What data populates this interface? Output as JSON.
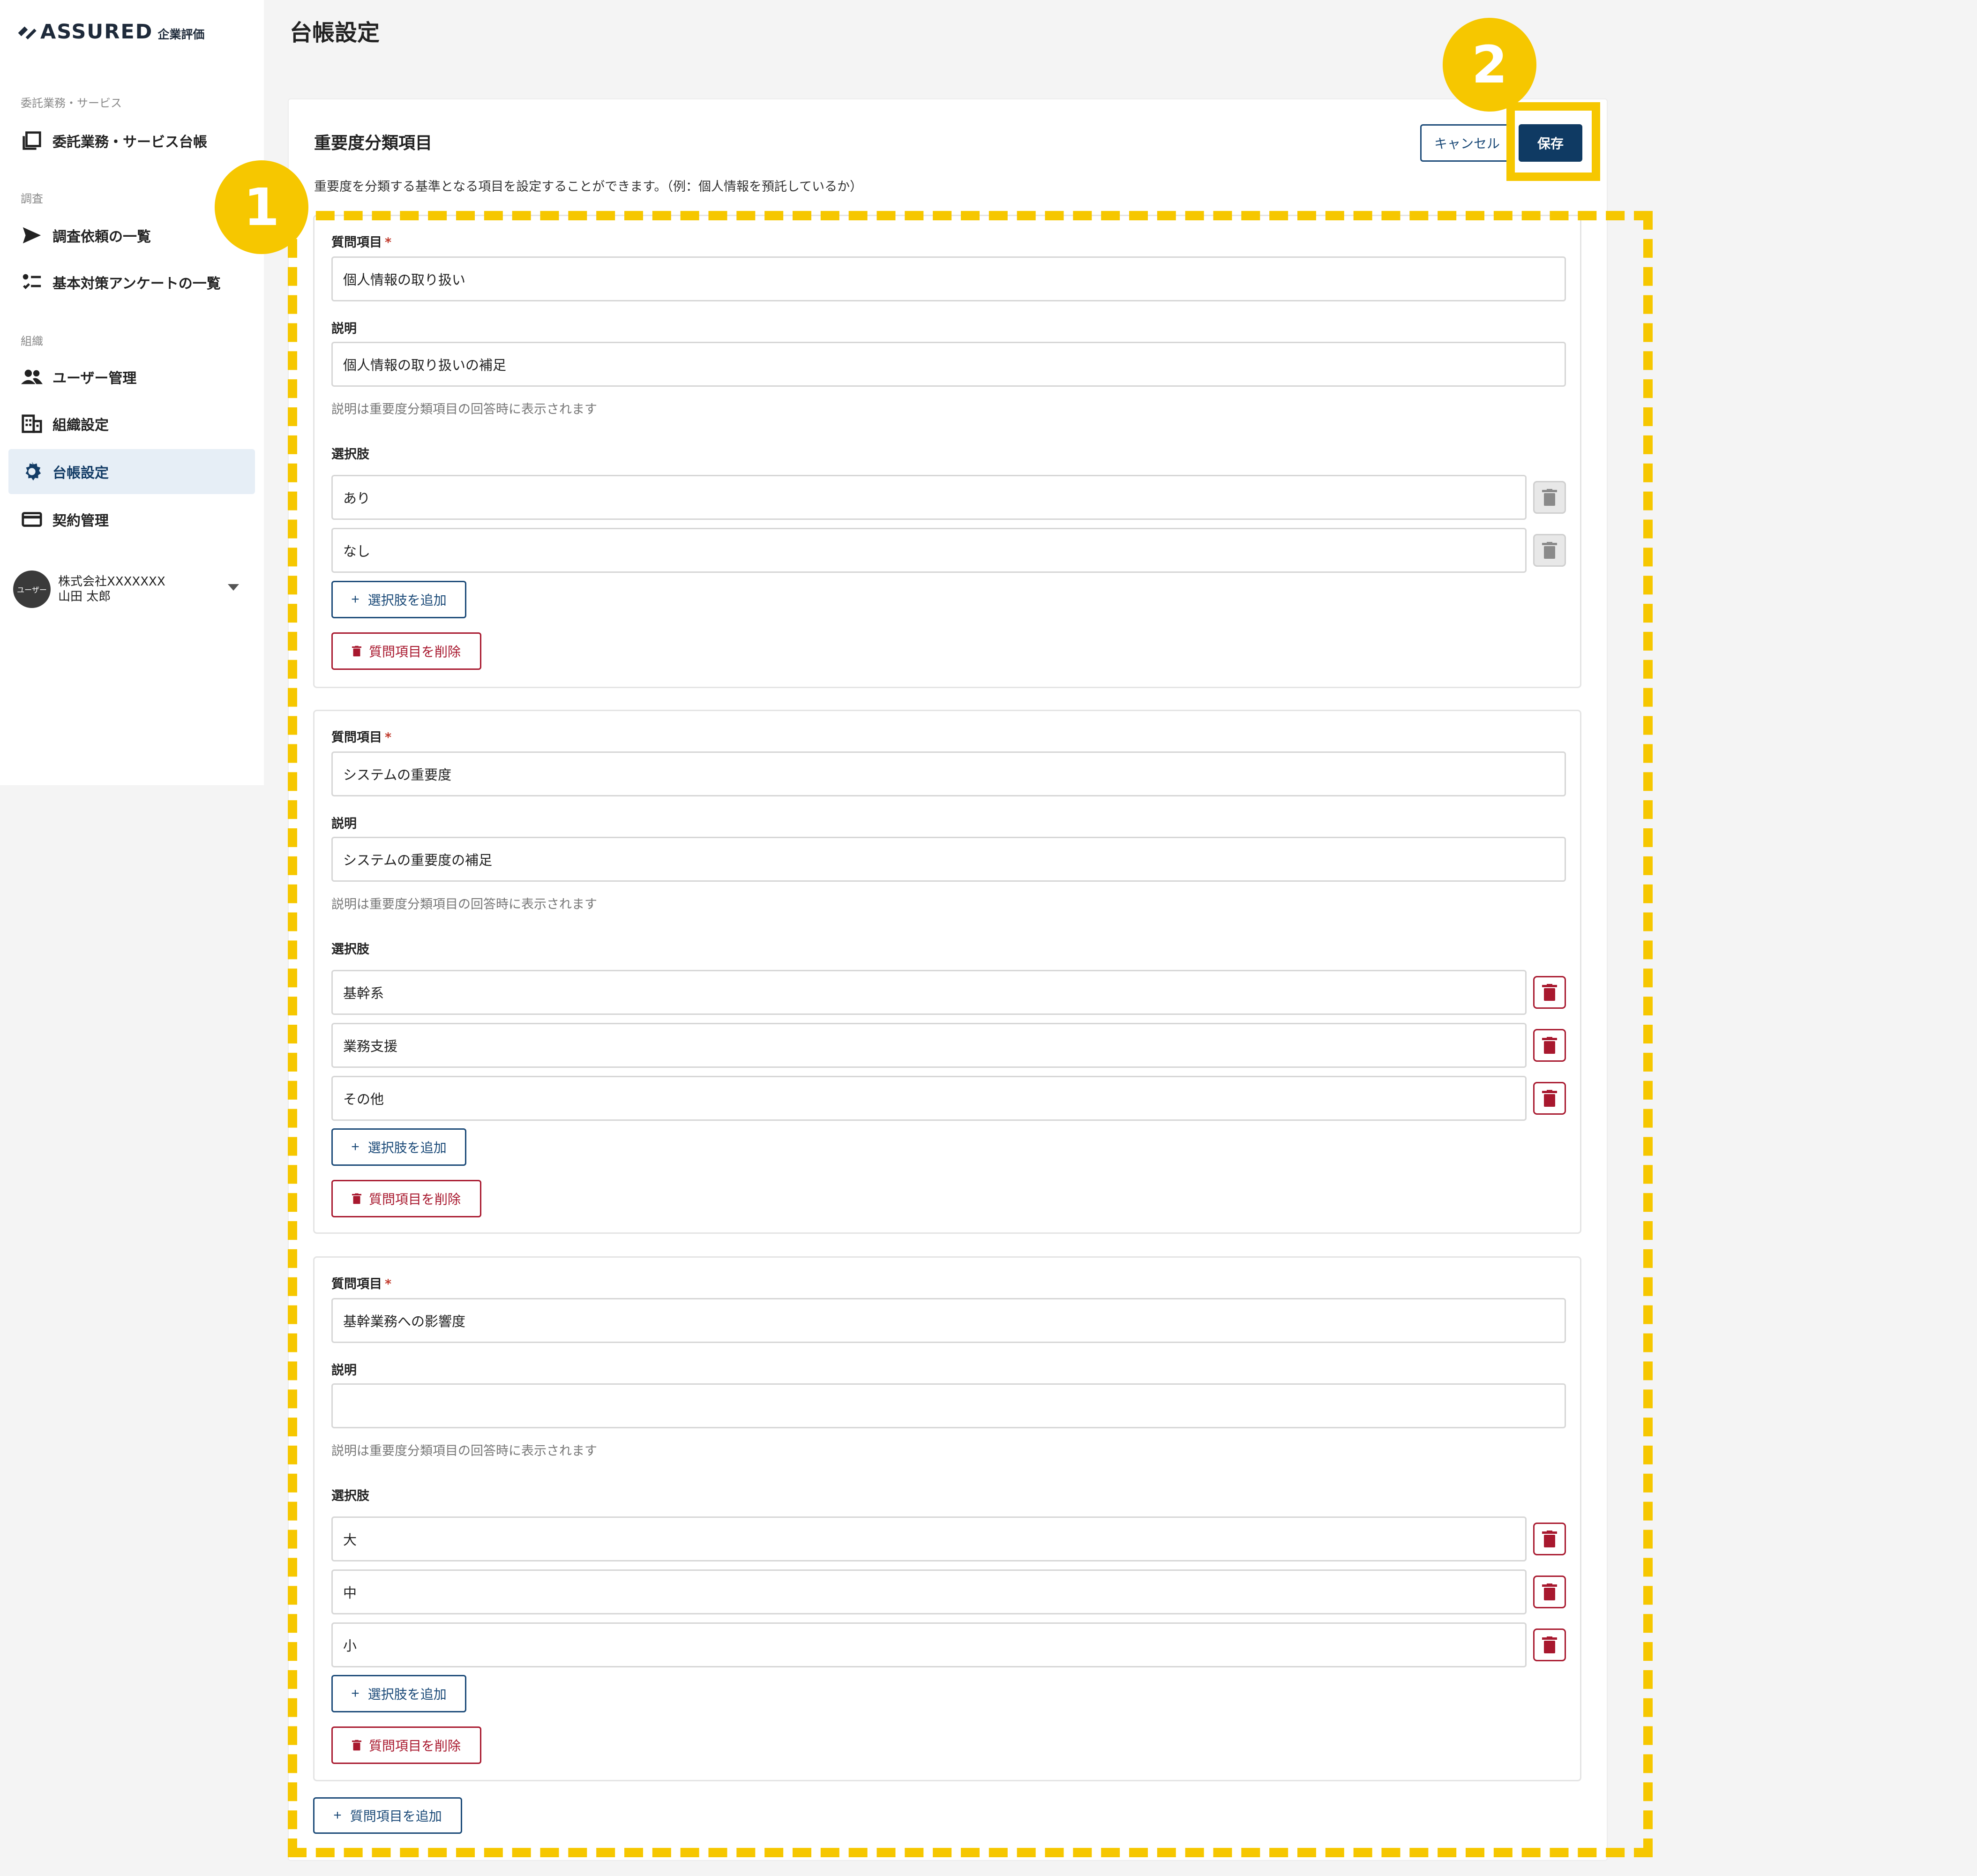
{
  "brand": {
    "name": "ASSURED",
    "sub": "企業評価"
  },
  "sidebar": {
    "sections": [
      {
        "label": "委託業務・サービス"
      },
      {
        "label": "調査"
      },
      {
        "label": "組織"
      }
    ],
    "items": [
      {
        "label": "委託業務・サービス台帳",
        "icon": "ledger-icon"
      },
      {
        "label": "調査依頼の一覧",
        "icon": "send-icon"
      },
      {
        "label": "基本対策アンケートの一覧",
        "icon": "checklist-icon"
      },
      {
        "label": "ユーザー管理",
        "icon": "users-icon"
      },
      {
        "label": "組織設定",
        "icon": "building-icon"
      },
      {
        "label": "台帳設定",
        "icon": "gear-icon",
        "active": true
      },
      {
        "label": "契約管理",
        "icon": "card-icon"
      }
    ],
    "user": {
      "avatar": "ユーザー",
      "company": "株式会社XXXXXXX",
      "name": "山田 太郎"
    }
  },
  "page": {
    "title": "台帳設定"
  },
  "section": {
    "title": "重要度分類項目",
    "description": "重要度を分類する基準となる項目を設定することができます。（例：個人情報を預託しているか）",
    "cancel_label": "キャンセル",
    "save_label": "保存"
  },
  "labels": {
    "question": "質問項目",
    "required_mark": "*",
    "description": "説明",
    "description_hint": "説明は重要度分類項目の回答時に表示されます",
    "options": "選択肢",
    "add_option": "選択肢を追加",
    "delete_question": "質問項目を削除",
    "add_question": "質問項目を追加",
    "plus": "+"
  },
  "questions": [
    {
      "question": "個人情報の取り扱い",
      "description": "個人情報の取り扱いの補足",
      "options": [
        "あり",
        "なし"
      ],
      "option_delete_enabled": false
    },
    {
      "question": "システムの重要度",
      "description": "システムの重要度の補足",
      "options": [
        "基幹系",
        "業務支援",
        "その他"
      ],
      "option_delete_enabled": true
    },
    {
      "question": "基幹業務への影響度",
      "description": "",
      "options": [
        "大",
        "中",
        "小"
      ],
      "option_delete_enabled": true
    }
  ],
  "annotations": {
    "badge_1": "1",
    "badge_2": "2"
  },
  "colors": {
    "accent": "#0f3a63",
    "danger": "#a8182e",
    "highlight": "#f6c700"
  }
}
